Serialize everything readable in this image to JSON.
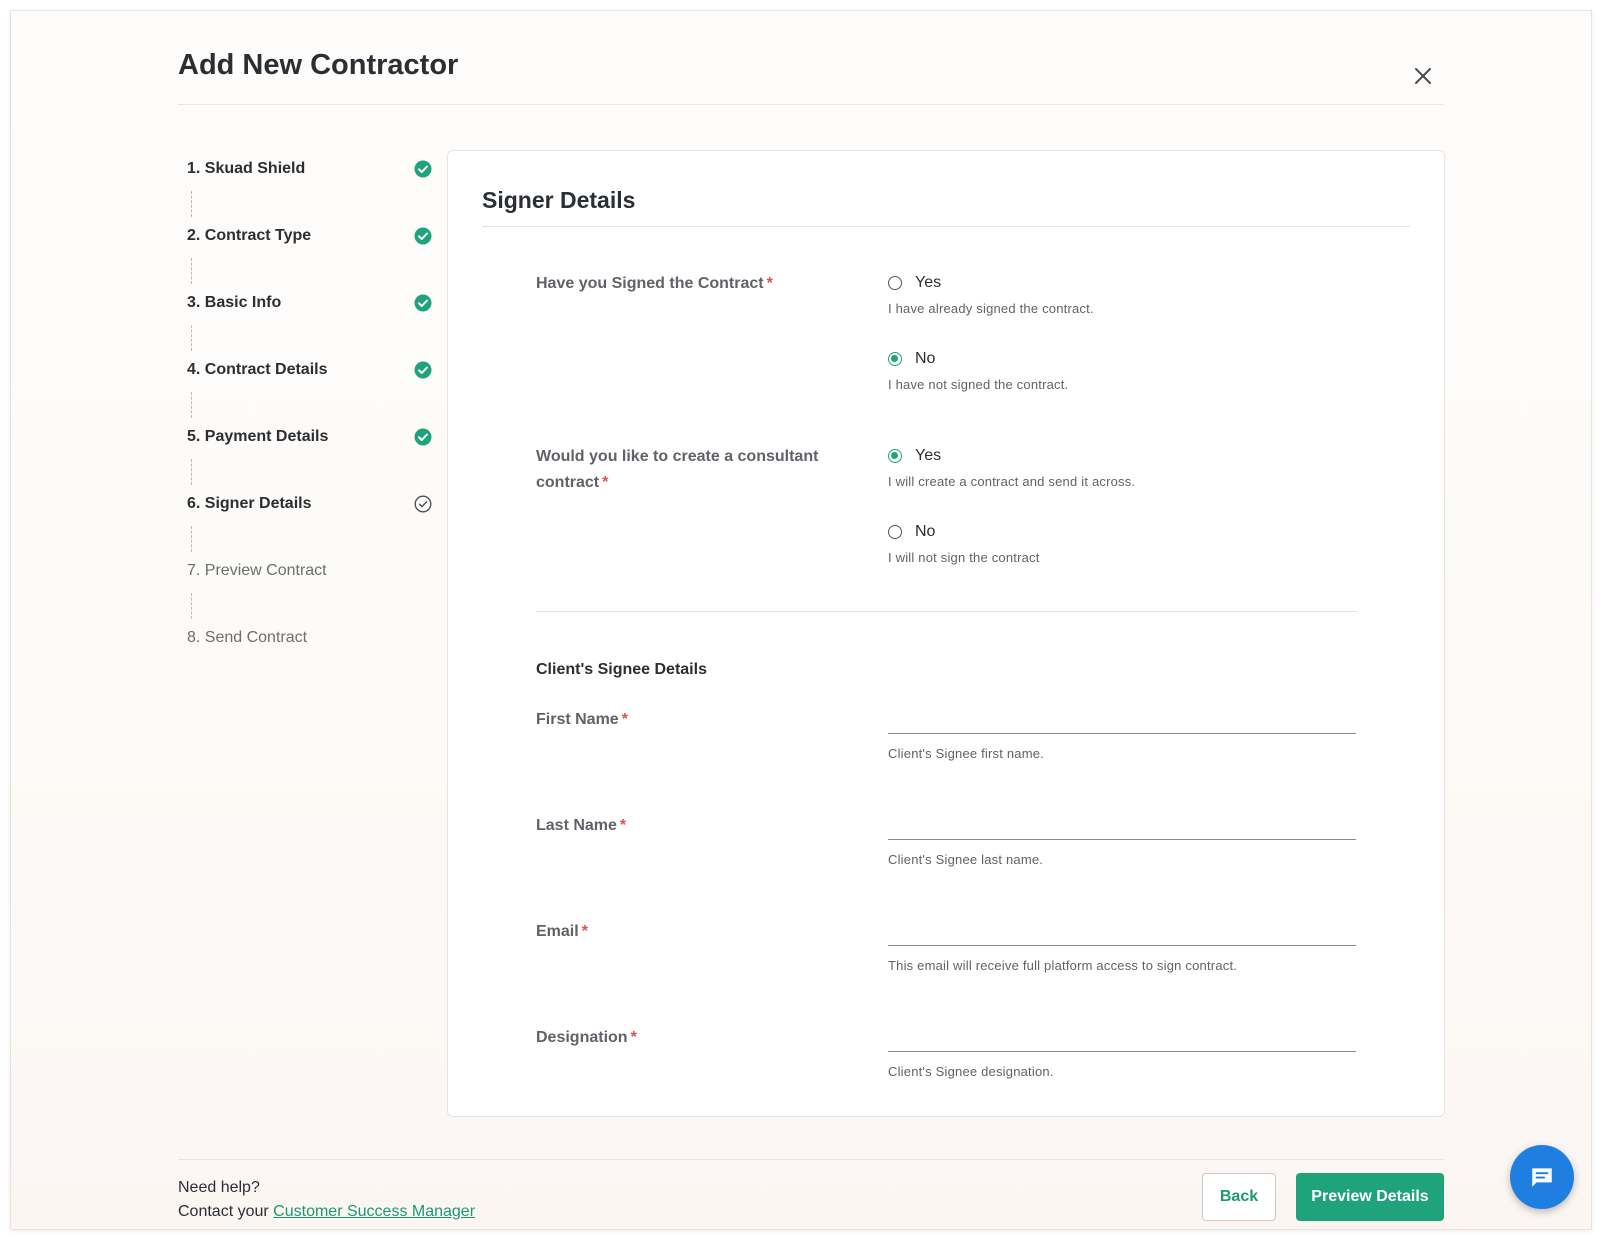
{
  "header": {
    "title": "Add New Contractor"
  },
  "stepper": {
    "steps": [
      {
        "label": "1. Skuad Shield",
        "status": "complete"
      },
      {
        "label": "2. Contract Type",
        "status": "complete"
      },
      {
        "label": "3. Basic Info",
        "status": "complete"
      },
      {
        "label": "4. Contract Details",
        "status": "complete"
      },
      {
        "label": "5. Payment Details",
        "status": "complete"
      },
      {
        "label": "6. Signer Details",
        "status": "current"
      },
      {
        "label": "7. Preview Contract",
        "status": "pending"
      },
      {
        "label": "8. Send Contract",
        "status": "pending"
      }
    ]
  },
  "form": {
    "title": "Signer Details",
    "signed_question": {
      "label": "Have you Signed the Contract",
      "options": [
        {
          "label": "Yes",
          "hint": "I have already signed the contract.",
          "selected": false
        },
        {
          "label": "No",
          "hint": "I have not signed the contract.",
          "selected": true
        }
      ]
    },
    "consultant_question": {
      "label": "Would you like to create a consultant contract",
      "options": [
        {
          "label": "Yes",
          "hint": "I will create a contract and send it across.",
          "selected": true
        },
        {
          "label": "No",
          "hint": "I will not sign the contract",
          "selected": false
        }
      ]
    },
    "signee_section": {
      "title": "Client's Signee Details",
      "fields": [
        {
          "label": "First Name",
          "value": "",
          "hint": "Client's Signee first name."
        },
        {
          "label": "Last Name",
          "value": "",
          "hint": "Client's Signee last name."
        },
        {
          "label": "Email",
          "value": "",
          "hint": "This email will receive full platform access to sign contract."
        },
        {
          "label": "Designation",
          "value": "",
          "hint": "Client's Signee designation."
        }
      ]
    },
    "required_mark": "*"
  },
  "footer": {
    "help_line1": "Need help?",
    "help_prefix": "Contact your",
    "help_link": "Customer Success Manager",
    "back_label": "Back",
    "preview_label": "Preview Details"
  },
  "colors": {
    "accent": "#1fa37b",
    "link": "#1a9a73",
    "required": "#e2504a",
    "chat": "#1f7fe0"
  },
  "icons": {
    "close": "close-icon",
    "step_complete": "check-circle-filled-icon",
    "step_current": "check-circle-outline-icon",
    "chat": "chat-icon"
  }
}
